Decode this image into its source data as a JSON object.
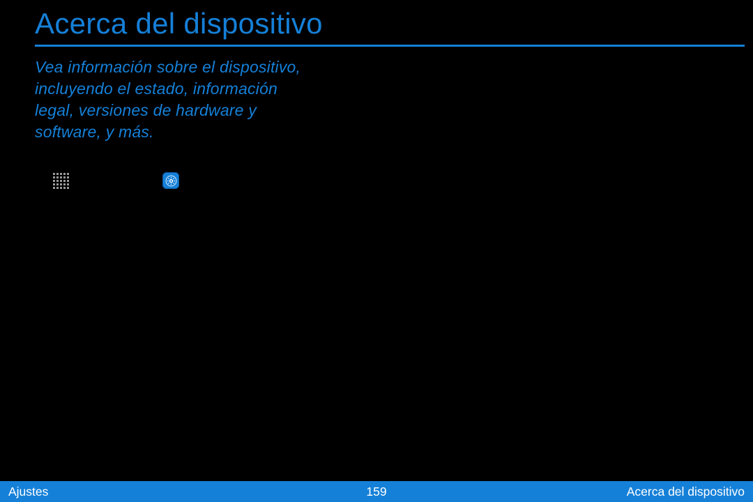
{
  "title": "Acerca del dispositivo",
  "intro": "Vea información sobre el dispositivo, incluyendo el estado, información legal, versiones de hardware y software, y más.",
  "footer": {
    "left": "Ajustes",
    "center": "159",
    "right": "Acerca del dispositivo"
  }
}
